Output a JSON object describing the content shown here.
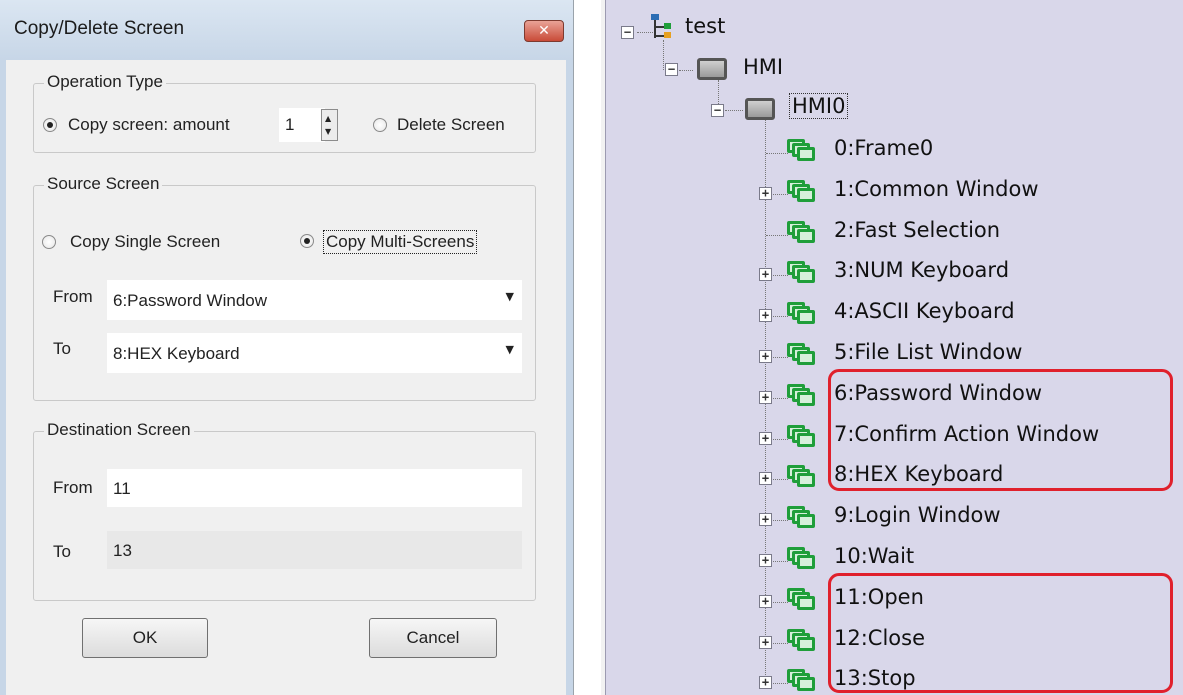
{
  "dialog": {
    "title": "Copy/Delete Screen",
    "close_glyph": "✕",
    "operation": {
      "legend": "Operation Type",
      "copy_label": "Copy screen: amount",
      "amount": "1",
      "delete_label": "Delete Screen",
      "selected": "copy"
    },
    "source": {
      "legend": "Source Screen",
      "single_label": "Copy Single Screen",
      "multi_label": "Copy Multi-Screens",
      "selected": "multi",
      "from_label": "From",
      "from_value": "6:Password Window",
      "to_label": "To",
      "to_value": "8:HEX Keyboard"
    },
    "destination": {
      "legend": "Destination Screen",
      "from_label": "From",
      "from_value": "11",
      "to_label": "To",
      "to_value": "13"
    },
    "ok_label": "OK",
    "cancel_label": "Cancel"
  },
  "tree": {
    "root": "test",
    "hmi": "HMI",
    "hmi0": "HMI0",
    "items": [
      "0:Frame0",
      "1:Common Window",
      "2:Fast Selection",
      "3:NUM Keyboard",
      "4:ASCII Keyboard",
      "5:File List Window",
      "6:Password Window",
      "7:Confirm Action Window",
      "8:HEX Keyboard",
      "9:Login Window",
      "10:Wait",
      "11:Open",
      "12:Close",
      "13:Stop"
    ],
    "expand_glyph": "+",
    "collapse_glyph": "−",
    "highlight_color": "#e0202c"
  }
}
